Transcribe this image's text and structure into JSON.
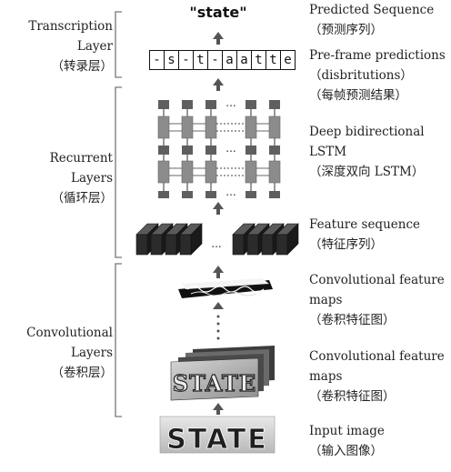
{
  "layers": {
    "transcription": [
      "Transcription",
      "Layer",
      "（转录层）"
    ],
    "recurrent": [
      "Recurrent",
      "Layers",
      "（循环层）"
    ],
    "convolutional": [
      "Convolutional",
      "Layers",
      "（卷积层）"
    ]
  },
  "output_word": "\"state\"",
  "frame_predictions": [
    "-",
    "s",
    "-",
    "t",
    "-",
    "a",
    "a",
    "t",
    "t",
    "e"
  ],
  "descriptions": {
    "predicted_sequence": [
      "Predicted Sequence",
      "（预测序列）"
    ],
    "frame_predictions": [
      "Pre-frame predictions",
      "（disbritutions）",
      "（每帧预测结果）"
    ],
    "bilstm": [
      "Deep bidirectional",
      "LSTM",
      "（深度双向 LSTM）"
    ],
    "feature_sequence": [
      "Feature sequence",
      "（特征序列）"
    ],
    "conv_maps_1": [
      "Convolutional feature",
      "maps",
      "（卷积特征图）"
    ],
    "conv_maps_2": [
      "Convolutional feature",
      "maps",
      "（卷积特征图）"
    ],
    "input_image": [
      "Input image",
      "（输入图像）"
    ]
  },
  "input_image_text": "STATE",
  "ellipsis": "...",
  "colors": {
    "lstm_cell": "#8c8c8c",
    "lstm_output": "#5f5f5f",
    "feature_block": "#2b2b2b",
    "bracket": "#777777",
    "arrow": "#555555"
  }
}
